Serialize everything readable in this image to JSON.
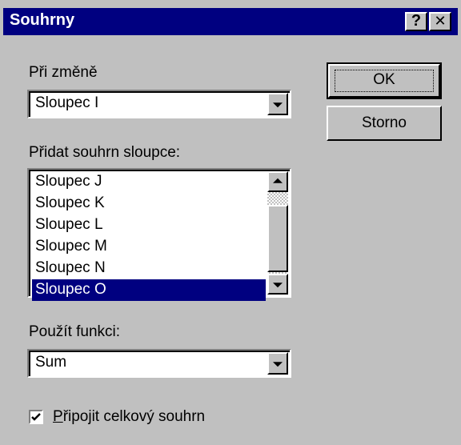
{
  "dialog": {
    "title": "Souhrny",
    "help_label": "?",
    "close_label": "✕"
  },
  "at_change": {
    "label": "Při změně",
    "value": "Sloupec I"
  },
  "add_subtotal": {
    "label": "Přidat souhrn sloupce:",
    "items": [
      {
        "label": "Sloupec J"
      },
      {
        "label": "Sloupec K"
      },
      {
        "label": "Sloupec L"
      },
      {
        "label": "Sloupec M"
      },
      {
        "label": "Sloupec N"
      },
      {
        "label": "Sloupec O"
      }
    ],
    "selected_item": "Sloupec O"
  },
  "use_function": {
    "label": "Použít funkci:",
    "value": "Sum"
  },
  "buttons": {
    "ok": "OK",
    "cancel": "Storno"
  },
  "grand_total": {
    "label_accel": "P",
    "label_rest": "řipojit celkový souhrn",
    "checked": true
  },
  "colors": {
    "title_bg": "#000080",
    "face": "#c0c0c0",
    "selection": "#000080"
  }
}
